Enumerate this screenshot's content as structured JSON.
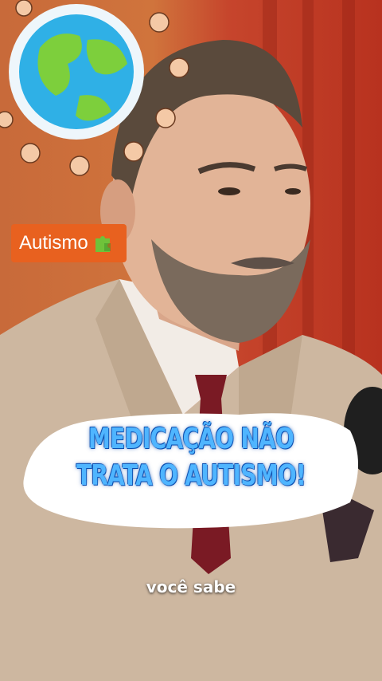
{
  "badge": {
    "label": "Autismo",
    "icon": "puzzle-icon",
    "color": "#e8611f"
  },
  "headline": {
    "line1": "MEDICAÇÃO NÃO",
    "line2": "TRATA O AUTISMO!",
    "color": "#4fb5ff"
  },
  "caption": {
    "text": "você sabe"
  }
}
